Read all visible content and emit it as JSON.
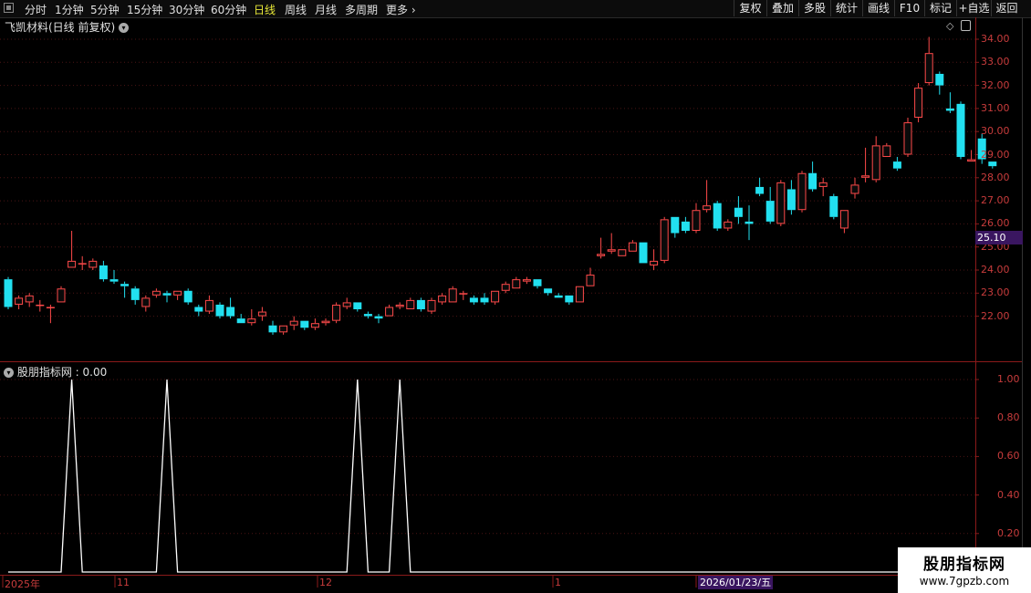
{
  "toolbar": {
    "timeframes": [
      "分时",
      "1分钟",
      "5分钟",
      "15分钟",
      "30分钟",
      "60分钟",
      "日线",
      "周线",
      "月线",
      "多周期",
      "更多"
    ],
    "active_timeframe": "日线",
    "buttons": [
      "复权",
      "叠加",
      "多股",
      "统计",
      "画线",
      "F10",
      "标记",
      "+自选",
      "返回"
    ]
  },
  "chart": {
    "title": "飞凯材料(日线 前复权)",
    "price_ticks": [
      "34.00",
      "33.00",
      "32.00",
      "31.00",
      "30.00",
      "29.00",
      "28.00",
      "27.00",
      "26.00",
      "25.00",
      "24.00",
      "23.00",
      "22.00"
    ],
    "current_price": "25.10"
  },
  "indicator": {
    "title": "股朋指标网 : 0.00",
    "ticks": [
      "1.00",
      "0.80",
      "0.60",
      "0.40",
      "0.20"
    ]
  },
  "time_axis": {
    "labels": [
      "2025年",
      "11",
      "12",
      "1"
    ],
    "cursor_date": "2026/01/23/五"
  },
  "watermark": {
    "name": "股朋指标网",
    "url": "www.7gpzb.com"
  },
  "chart_data": {
    "type": "candlestick",
    "ylim": [
      21.0,
      34.4
    ],
    "candles": [
      {
        "o": 23.6,
        "h": 23.7,
        "l": 22.3,
        "c": 22.4
      },
      {
        "o": 22.5,
        "h": 22.9,
        "l": 22.3,
        "c": 22.8
      },
      {
        "o": 22.6,
        "h": 23.0,
        "l": 22.4,
        "c": 22.9
      },
      {
        "o": 22.5,
        "h": 22.7,
        "l": 22.2,
        "c": 22.5
      },
      {
        "o": 22.4,
        "h": 22.5,
        "l": 21.7,
        "c": 22.4
      },
      {
        "o": 22.6,
        "h": 23.3,
        "l": 22.6,
        "c": 23.2
      },
      {
        "o": 24.1,
        "h": 25.7,
        "l": 24.1,
        "c": 24.4
      },
      {
        "o": 24.3,
        "h": 24.6,
        "l": 24.0,
        "c": 24.3
      },
      {
        "o": 24.1,
        "h": 24.5,
        "l": 24.0,
        "c": 24.4
      },
      {
        "o": 24.2,
        "h": 24.4,
        "l": 23.5,
        "c": 23.6
      },
      {
        "o": 23.6,
        "h": 24.0,
        "l": 23.4,
        "c": 23.5
      },
      {
        "o": 23.4,
        "h": 23.5,
        "l": 22.8,
        "c": 23.3
      },
      {
        "o": 23.2,
        "h": 23.3,
        "l": 22.5,
        "c": 22.7
      },
      {
        "o": 22.4,
        "h": 22.9,
        "l": 22.2,
        "c": 22.8
      },
      {
        "o": 22.9,
        "h": 23.2,
        "l": 22.8,
        "c": 23.1
      },
      {
        "o": 23.0,
        "h": 23.1,
        "l": 22.6,
        "c": 22.9
      },
      {
        "o": 22.9,
        "h": 23.1,
        "l": 22.7,
        "c": 23.1
      },
      {
        "o": 23.1,
        "h": 23.2,
        "l": 22.5,
        "c": 22.6
      },
      {
        "o": 22.4,
        "h": 22.5,
        "l": 22.0,
        "c": 22.2
      },
      {
        "o": 22.2,
        "h": 22.9,
        "l": 22.1,
        "c": 22.7
      },
      {
        "o": 22.5,
        "h": 22.6,
        "l": 21.9,
        "c": 22.0
      },
      {
        "o": 22.4,
        "h": 22.8,
        "l": 21.9,
        "c": 22.0
      },
      {
        "o": 21.9,
        "h": 22.1,
        "l": 21.7,
        "c": 21.7
      },
      {
        "o": 21.7,
        "h": 22.3,
        "l": 21.6,
        "c": 21.9
      },
      {
        "o": 22.0,
        "h": 22.4,
        "l": 21.8,
        "c": 22.2
      },
      {
        "o": 21.6,
        "h": 21.8,
        "l": 21.2,
        "c": 21.3
      },
      {
        "o": 21.3,
        "h": 21.6,
        "l": 21.2,
        "c": 21.6
      },
      {
        "o": 21.6,
        "h": 22.0,
        "l": 21.4,
        "c": 21.8
      },
      {
        "o": 21.8,
        "h": 21.8,
        "l": 21.4,
        "c": 21.5
      },
      {
        "o": 21.5,
        "h": 21.9,
        "l": 21.4,
        "c": 21.7
      },
      {
        "o": 21.7,
        "h": 21.9,
        "l": 21.6,
        "c": 21.8
      },
      {
        "o": 21.8,
        "h": 22.6,
        "l": 21.7,
        "c": 22.5
      },
      {
        "o": 22.4,
        "h": 22.8,
        "l": 22.3,
        "c": 22.6
      },
      {
        "o": 22.6,
        "h": 22.6,
        "l": 22.2,
        "c": 22.3
      },
      {
        "o": 22.1,
        "h": 22.2,
        "l": 21.9,
        "c": 22.0
      },
      {
        "o": 22.0,
        "h": 22.1,
        "l": 21.7,
        "c": 21.9
      },
      {
        "o": 22.0,
        "h": 22.5,
        "l": 22.0,
        "c": 22.4
      },
      {
        "o": 22.4,
        "h": 22.6,
        "l": 22.3,
        "c": 22.5
      },
      {
        "o": 22.3,
        "h": 22.8,
        "l": 22.3,
        "c": 22.7
      },
      {
        "o": 22.7,
        "h": 22.8,
        "l": 22.2,
        "c": 22.3
      },
      {
        "o": 22.2,
        "h": 22.8,
        "l": 22.1,
        "c": 22.7
      },
      {
        "o": 22.6,
        "h": 23.0,
        "l": 22.5,
        "c": 22.9
      },
      {
        "o": 22.6,
        "h": 23.3,
        "l": 22.6,
        "c": 23.2
      },
      {
        "o": 23.0,
        "h": 23.1,
        "l": 22.7,
        "c": 23.0
      },
      {
        "o": 22.8,
        "h": 22.9,
        "l": 22.5,
        "c": 22.6
      },
      {
        "o": 22.8,
        "h": 23.0,
        "l": 22.5,
        "c": 22.6
      },
      {
        "o": 22.6,
        "h": 23.1,
        "l": 22.5,
        "c": 23.1
      },
      {
        "o": 23.1,
        "h": 23.5,
        "l": 23.0,
        "c": 23.4
      },
      {
        "o": 23.2,
        "h": 23.7,
        "l": 23.2,
        "c": 23.6
      },
      {
        "o": 23.5,
        "h": 23.7,
        "l": 23.4,
        "c": 23.6
      },
      {
        "o": 23.6,
        "h": 23.6,
        "l": 23.2,
        "c": 23.3
      },
      {
        "o": 23.2,
        "h": 23.2,
        "l": 22.9,
        "c": 23.0
      },
      {
        "o": 22.9,
        "h": 23.0,
        "l": 22.8,
        "c": 22.8
      },
      {
        "o": 22.9,
        "h": 22.9,
        "l": 22.5,
        "c": 22.6
      },
      {
        "o": 22.6,
        "h": 23.3,
        "l": 22.6,
        "c": 23.3
      },
      {
        "o": 23.3,
        "h": 24.1,
        "l": 23.3,
        "c": 23.8
      },
      {
        "o": 24.6,
        "h": 25.4,
        "l": 24.5,
        "c": 24.7
      },
      {
        "o": 24.8,
        "h": 25.6,
        "l": 24.7,
        "c": 24.9
      },
      {
        "o": 24.6,
        "h": 24.9,
        "l": 24.6,
        "c": 24.9
      },
      {
        "o": 24.8,
        "h": 25.3,
        "l": 24.8,
        "c": 25.2
      },
      {
        "o": 25.2,
        "h": 25.2,
        "l": 24.3,
        "c": 24.3
      },
      {
        "o": 24.2,
        "h": 24.9,
        "l": 24.0,
        "c": 24.4
      },
      {
        "o": 24.4,
        "h": 26.3,
        "l": 24.3,
        "c": 26.2
      },
      {
        "o": 26.3,
        "h": 26.3,
        "l": 25.4,
        "c": 25.6
      },
      {
        "o": 26.1,
        "h": 26.3,
        "l": 25.6,
        "c": 25.7
      },
      {
        "o": 25.7,
        "h": 26.9,
        "l": 25.6,
        "c": 26.6
      },
      {
        "o": 26.6,
        "h": 27.9,
        "l": 26.5,
        "c": 26.8
      },
      {
        "o": 26.9,
        "h": 27.0,
        "l": 25.7,
        "c": 25.8
      },
      {
        "o": 25.8,
        "h": 26.2,
        "l": 25.7,
        "c": 26.1
      },
      {
        "o": 26.7,
        "h": 27.2,
        "l": 26.0,
        "c": 26.3
      },
      {
        "o": 26.1,
        "h": 26.8,
        "l": 25.3,
        "c": 26.0
      },
      {
        "o": 27.6,
        "h": 28.0,
        "l": 27.2,
        "c": 27.3
      },
      {
        "o": 27.0,
        "h": 27.6,
        "l": 26.0,
        "c": 26.1
      },
      {
        "o": 26.0,
        "h": 27.9,
        "l": 25.9,
        "c": 27.8
      },
      {
        "o": 27.5,
        "h": 27.9,
        "l": 26.4,
        "c": 26.6
      },
      {
        "o": 26.6,
        "h": 28.3,
        "l": 26.5,
        "c": 28.2
      },
      {
        "o": 28.2,
        "h": 28.7,
        "l": 27.4,
        "c": 27.5
      },
      {
        "o": 27.6,
        "h": 28.0,
        "l": 27.2,
        "c": 27.8
      },
      {
        "o": 27.2,
        "h": 27.3,
        "l": 26.2,
        "c": 26.3
      },
      {
        "o": 25.8,
        "h": 26.6,
        "l": 25.6,
        "c": 26.6
      },
      {
        "o": 27.3,
        "h": 28.0,
        "l": 27.1,
        "c": 27.7
      },
      {
        "o": 28.0,
        "h": 29.3,
        "l": 27.8,
        "c": 28.1
      },
      {
        "o": 27.9,
        "h": 29.8,
        "l": 27.8,
        "c": 29.4
      },
      {
        "o": 28.9,
        "h": 29.5,
        "l": 28.9,
        "c": 29.4
      },
      {
        "o": 28.7,
        "h": 28.9,
        "l": 28.3,
        "c": 28.4
      },
      {
        "o": 29.0,
        "h": 30.6,
        "l": 28.9,
        "c": 30.4
      },
      {
        "o": 30.6,
        "h": 32.1,
        "l": 30.4,
        "c": 31.9
      },
      {
        "o": 32.1,
        "h": 34.1,
        "l": 32.0,
        "c": 33.4
      },
      {
        "o": 32.5,
        "h": 32.6,
        "l": 31.6,
        "c": 32.0
      },
      {
        "o": 31.0,
        "h": 31.7,
        "l": 30.8,
        "c": 30.9
      },
      {
        "o": 31.2,
        "h": 31.3,
        "l": 28.8,
        "c": 28.9
      },
      {
        "o": 28.7,
        "h": 29.2,
        "l": 28.7,
        "c": 28.8
      },
      {
        "o": 29.7,
        "h": 29.9,
        "l": 28.6,
        "c": 28.8
      },
      {
        "o": 28.7,
        "h": 28.7,
        "l": 28.4,
        "c": 28.5
      }
    ],
    "indicator_series": {
      "name": "股朋指标网",
      "ylim": [
        0,
        1.0
      ],
      "spikes_at_index": [
        6,
        15,
        33,
        37
      ]
    }
  }
}
